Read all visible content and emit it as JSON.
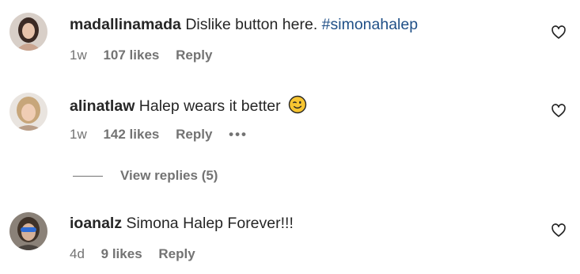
{
  "comments": [
    {
      "username": "madallinamada",
      "text": "Dislike button here.",
      "hashtag": "#simonahalep",
      "time": "1w",
      "likes": "107 likes",
      "reply_label": "Reply",
      "like_icon": "heart-outline-icon"
    },
    {
      "username": "alinatlaw",
      "text": "Halep wears it better",
      "emoji": "winking-face-emoji",
      "time": "1w",
      "likes": "142 likes",
      "reply_label": "Reply",
      "more_label": "•••",
      "like_icon": "heart-outline-icon",
      "view_replies": "View replies (5)"
    },
    {
      "username": "ioanalz",
      "text": "Simona Halep Forever!!!",
      "time": "4d",
      "likes": "9 likes",
      "reply_label": "Reply",
      "like_icon": "heart-outline-icon"
    }
  ],
  "colors": {
    "text": "#262626",
    "secondary": "#737373",
    "hashtag": "#1f4f87",
    "emoji": "#f7c531"
  }
}
